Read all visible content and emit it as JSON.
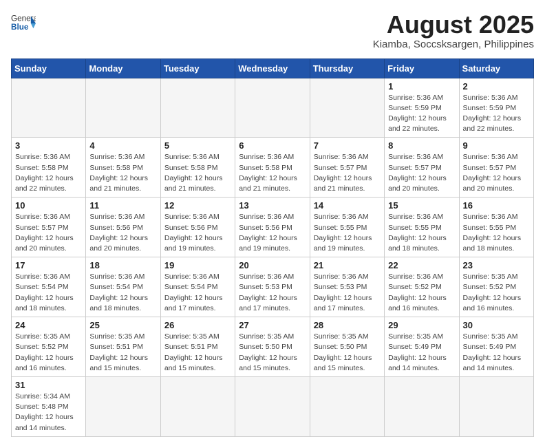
{
  "header": {
    "logo_general": "General",
    "logo_blue": "Blue",
    "title": "August 2025",
    "subtitle": "Kiamba, Soccsksargen, Philippines"
  },
  "weekdays": [
    "Sunday",
    "Monday",
    "Tuesday",
    "Wednesday",
    "Thursday",
    "Friday",
    "Saturday"
  ],
  "weeks": [
    [
      {
        "day": "",
        "info": ""
      },
      {
        "day": "",
        "info": ""
      },
      {
        "day": "",
        "info": ""
      },
      {
        "day": "",
        "info": ""
      },
      {
        "day": "",
        "info": ""
      },
      {
        "day": "1",
        "info": "Sunrise: 5:36 AM\nSunset: 5:59 PM\nDaylight: 12 hours\nand 22 minutes."
      },
      {
        "day": "2",
        "info": "Sunrise: 5:36 AM\nSunset: 5:59 PM\nDaylight: 12 hours\nand 22 minutes."
      }
    ],
    [
      {
        "day": "3",
        "info": "Sunrise: 5:36 AM\nSunset: 5:58 PM\nDaylight: 12 hours\nand 22 minutes."
      },
      {
        "day": "4",
        "info": "Sunrise: 5:36 AM\nSunset: 5:58 PM\nDaylight: 12 hours\nand 21 minutes."
      },
      {
        "day": "5",
        "info": "Sunrise: 5:36 AM\nSunset: 5:58 PM\nDaylight: 12 hours\nand 21 minutes."
      },
      {
        "day": "6",
        "info": "Sunrise: 5:36 AM\nSunset: 5:58 PM\nDaylight: 12 hours\nand 21 minutes."
      },
      {
        "day": "7",
        "info": "Sunrise: 5:36 AM\nSunset: 5:57 PM\nDaylight: 12 hours\nand 21 minutes."
      },
      {
        "day": "8",
        "info": "Sunrise: 5:36 AM\nSunset: 5:57 PM\nDaylight: 12 hours\nand 20 minutes."
      },
      {
        "day": "9",
        "info": "Sunrise: 5:36 AM\nSunset: 5:57 PM\nDaylight: 12 hours\nand 20 minutes."
      }
    ],
    [
      {
        "day": "10",
        "info": "Sunrise: 5:36 AM\nSunset: 5:57 PM\nDaylight: 12 hours\nand 20 minutes."
      },
      {
        "day": "11",
        "info": "Sunrise: 5:36 AM\nSunset: 5:56 PM\nDaylight: 12 hours\nand 20 minutes."
      },
      {
        "day": "12",
        "info": "Sunrise: 5:36 AM\nSunset: 5:56 PM\nDaylight: 12 hours\nand 19 minutes."
      },
      {
        "day": "13",
        "info": "Sunrise: 5:36 AM\nSunset: 5:56 PM\nDaylight: 12 hours\nand 19 minutes."
      },
      {
        "day": "14",
        "info": "Sunrise: 5:36 AM\nSunset: 5:55 PM\nDaylight: 12 hours\nand 19 minutes."
      },
      {
        "day": "15",
        "info": "Sunrise: 5:36 AM\nSunset: 5:55 PM\nDaylight: 12 hours\nand 18 minutes."
      },
      {
        "day": "16",
        "info": "Sunrise: 5:36 AM\nSunset: 5:55 PM\nDaylight: 12 hours\nand 18 minutes."
      }
    ],
    [
      {
        "day": "17",
        "info": "Sunrise: 5:36 AM\nSunset: 5:54 PM\nDaylight: 12 hours\nand 18 minutes."
      },
      {
        "day": "18",
        "info": "Sunrise: 5:36 AM\nSunset: 5:54 PM\nDaylight: 12 hours\nand 18 minutes."
      },
      {
        "day": "19",
        "info": "Sunrise: 5:36 AM\nSunset: 5:54 PM\nDaylight: 12 hours\nand 17 minutes."
      },
      {
        "day": "20",
        "info": "Sunrise: 5:36 AM\nSunset: 5:53 PM\nDaylight: 12 hours\nand 17 minutes."
      },
      {
        "day": "21",
        "info": "Sunrise: 5:36 AM\nSunset: 5:53 PM\nDaylight: 12 hours\nand 17 minutes."
      },
      {
        "day": "22",
        "info": "Sunrise: 5:36 AM\nSunset: 5:52 PM\nDaylight: 12 hours\nand 16 minutes."
      },
      {
        "day": "23",
        "info": "Sunrise: 5:35 AM\nSunset: 5:52 PM\nDaylight: 12 hours\nand 16 minutes."
      }
    ],
    [
      {
        "day": "24",
        "info": "Sunrise: 5:35 AM\nSunset: 5:52 PM\nDaylight: 12 hours\nand 16 minutes."
      },
      {
        "day": "25",
        "info": "Sunrise: 5:35 AM\nSunset: 5:51 PM\nDaylight: 12 hours\nand 15 minutes."
      },
      {
        "day": "26",
        "info": "Sunrise: 5:35 AM\nSunset: 5:51 PM\nDaylight: 12 hours\nand 15 minutes."
      },
      {
        "day": "27",
        "info": "Sunrise: 5:35 AM\nSunset: 5:50 PM\nDaylight: 12 hours\nand 15 minutes."
      },
      {
        "day": "28",
        "info": "Sunrise: 5:35 AM\nSunset: 5:50 PM\nDaylight: 12 hours\nand 15 minutes."
      },
      {
        "day": "29",
        "info": "Sunrise: 5:35 AM\nSunset: 5:49 PM\nDaylight: 12 hours\nand 14 minutes."
      },
      {
        "day": "30",
        "info": "Sunrise: 5:35 AM\nSunset: 5:49 PM\nDaylight: 12 hours\nand 14 minutes."
      }
    ],
    [
      {
        "day": "31",
        "info": "Sunrise: 5:34 AM\nSunset: 5:48 PM\nDaylight: 12 hours\nand 14 minutes."
      },
      {
        "day": "",
        "info": ""
      },
      {
        "day": "",
        "info": ""
      },
      {
        "day": "",
        "info": ""
      },
      {
        "day": "",
        "info": ""
      },
      {
        "day": "",
        "info": ""
      },
      {
        "day": "",
        "info": ""
      }
    ]
  ]
}
